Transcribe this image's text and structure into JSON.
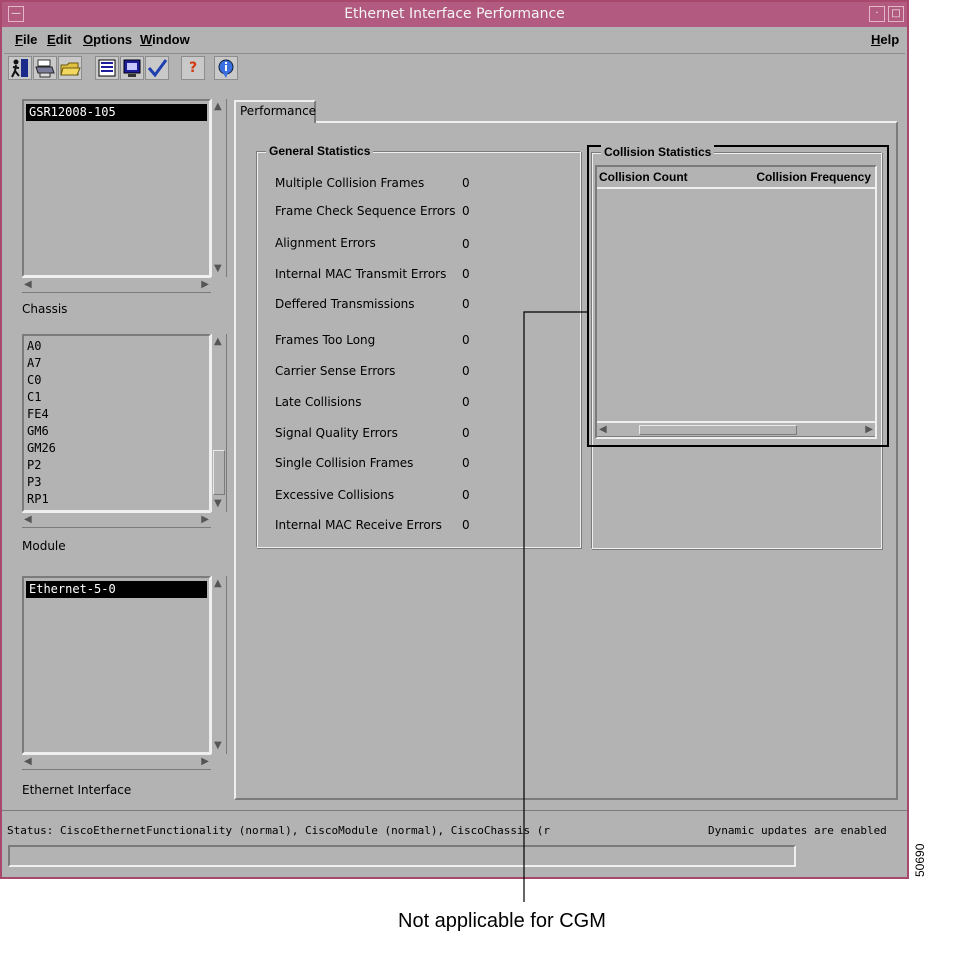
{
  "window": {
    "title": "Ethernet Interface Performance",
    "title_buttons": [
      "—",
      "·",
      "□"
    ]
  },
  "menu": {
    "items": [
      {
        "underline": "F",
        "rest": "ile"
      },
      {
        "underline": "E",
        "rest": "dit"
      },
      {
        "underline": "O",
        "rest": "ptions"
      },
      {
        "underline": "W",
        "rest": "indow"
      }
    ],
    "help": {
      "underline": "H",
      "rest": "elp"
    }
  },
  "toolbar": {
    "icons": [
      "exit-icon",
      "print-icon",
      "open-folder-icon",
      "list-view-icon",
      "monitor-icon",
      "checkmark-icon",
      "help-question-icon",
      "info-icon"
    ]
  },
  "chassis": {
    "items": [
      "GSR12008-105"
    ],
    "label": "Chassis"
  },
  "module": {
    "items": [
      "A0",
      "A7",
      "C0",
      "C1",
      "FE4",
      "GM6",
      "GM26",
      "P2",
      "P3",
      "RP1"
    ],
    "label": "Module"
  },
  "ethernet": {
    "items": [
      "Ethernet-5-0"
    ],
    "label": "Ethernet Interface"
  },
  "tab": {
    "label": "Performance"
  },
  "general": {
    "title": "General Statistics",
    "rows": [
      {
        "label": "Multiple Collision Frames",
        "value": "0"
      },
      {
        "label": "Frame Check Sequence Errors",
        "value": "0"
      },
      {
        "label": "Alignment Errors",
        "value": "0"
      },
      {
        "label": "Internal MAC Transmit Errors",
        "value": "0"
      },
      {
        "label": "Deffered Transmissions",
        "value": "0"
      },
      {
        "label": "Frames Too Long",
        "value": "0"
      },
      {
        "label": "Carrier Sense Errors",
        "value": "0"
      },
      {
        "label": "Late Collisions",
        "value": "0"
      },
      {
        "label": "Signal Quality Errors",
        "value": "0"
      },
      {
        "label": "Single Collision Frames",
        "value": "0"
      },
      {
        "label": "Excessive Collisions",
        "value": "0"
      },
      {
        "label": "Internal MAC Receive Errors",
        "value": "0"
      }
    ]
  },
  "collision": {
    "title": "Collision Statistics",
    "col_count": "Collision Count",
    "col_frequency": "Collision Frequency"
  },
  "status": {
    "text": "Status: CiscoEthernetFunctionality (normal), CiscoModule (normal), CiscoChassis (r",
    "dynamic": "Dynamic updates are enabled"
  },
  "annotation": {
    "text": "Not applicable for CGM",
    "figure_number": "50690"
  }
}
